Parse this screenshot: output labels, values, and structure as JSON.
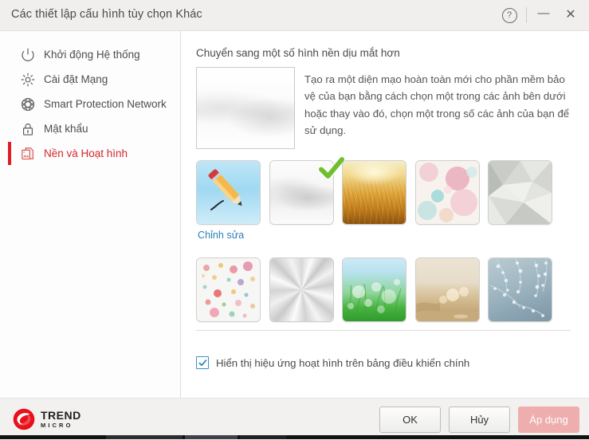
{
  "window": {
    "title": "Các thiết lập cấu hình tùy chọn Khác",
    "help_icon": "help-question-icon",
    "minimize_icon": "minimize-icon",
    "close_icon": "close-icon"
  },
  "sidebar": {
    "items": [
      {
        "label": "Khởi động Hệ thống",
        "icon": "power-icon",
        "active": false
      },
      {
        "label": "Cài đặt Mạng",
        "icon": "gear-icon",
        "active": false
      },
      {
        "label": "Smart Protection Network",
        "icon": "globe-network-icon",
        "active": false
      },
      {
        "label": "Mật khẩu",
        "icon": "lock-icon",
        "active": false
      },
      {
        "label": "Nền và Hoạt hình",
        "icon": "image-stack-icon",
        "active": true
      }
    ]
  },
  "panel": {
    "heading": "Chuyển sang một số hình nền dịu mắt hơn",
    "description": "Tạo ra một diện mạo hoàn toàn mới cho phần mềm bảo vệ của bạn bằng cách chọn một trong các ảnh bên dưới hoặc thay vào đó, chọn một trong số các ảnh của bạn để sử dụng.",
    "preview_name": "current-wallpaper-preview",
    "thumbnails": [
      {
        "name": "edit-wallpaper",
        "art": "art-edit",
        "label": "Chỉnh sửa",
        "selected": false
      },
      {
        "name": "wallpaper-soft-grey",
        "art": "art-grey",
        "label": "",
        "selected": true
      },
      {
        "name": "wallpaper-wheat-field",
        "art": "art-wheat",
        "label": "",
        "selected": false
      },
      {
        "name": "wallpaper-pastel-dots",
        "art": "art-dots-pastel",
        "label": "",
        "selected": false
      },
      {
        "name": "wallpaper-grey-polygons",
        "art": "art-poly",
        "label": "",
        "selected": false
      },
      {
        "name": "wallpaper-color-dots",
        "art": "art-dots-color",
        "label": "",
        "selected": false
      },
      {
        "name": "wallpaper-brushed-metal",
        "art": "art-metal",
        "label": "",
        "selected": false
      },
      {
        "name": "wallpaper-green-grass",
        "art": "art-grass",
        "label": "",
        "selected": false
      },
      {
        "name": "wallpaper-sand-beach",
        "art": "art-sand",
        "label": "",
        "selected": false
      },
      {
        "name": "wallpaper-blue-floral",
        "art": "art-floral",
        "label": "",
        "selected": false
      }
    ],
    "checkbox": {
      "label": "Hiển thị hiệu ứng hoạt hình trên bảng điều khiển chính",
      "checked": true
    }
  },
  "footer": {
    "brand_line1": "TREND",
    "brand_line2": "MICRO",
    "buttons": {
      "ok": "OK",
      "cancel": "Hủy",
      "apply": "Áp dụng"
    }
  },
  "colors": {
    "accent_red": "#d5262b",
    "link_blue": "#2d7fb8",
    "checkbox_blue": "#3d8fc7",
    "apply_pink": "#eeaeae",
    "titlebar_bg": "#f0efed"
  }
}
